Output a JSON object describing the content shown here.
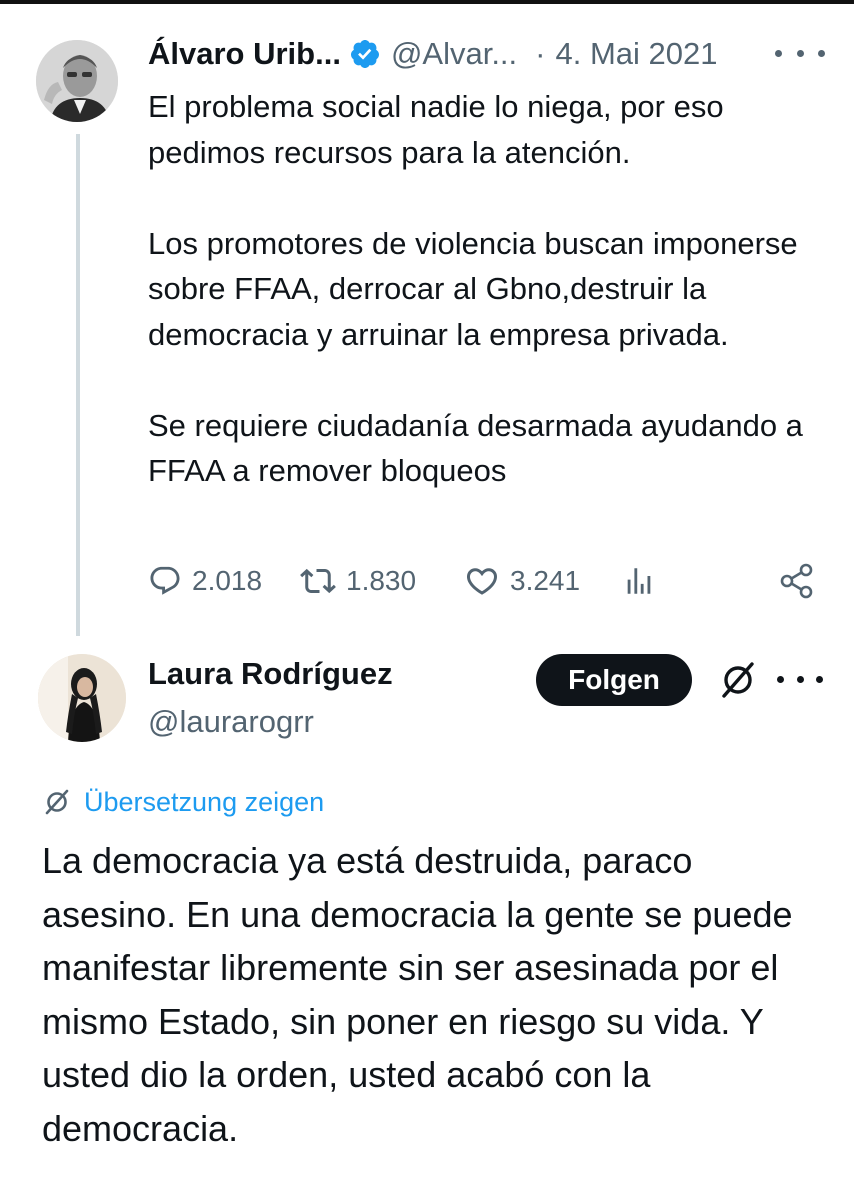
{
  "original_tweet": {
    "display_name": "Álvaro Urib...",
    "handle": "@Alvar...",
    "separator": "·",
    "date": "4. Mai 2021",
    "paragraphs": [
      "El problema social nadie lo niega, por eso pedimos recursos para la atención.",
      "Los promotores de violencia buscan imponerse sobre FFAA, derrocar al Gbno,destruir la democracia y arruinar la empresa privada.",
      "Se requiere ciudadanía desarmada ayudando a FFAA a remover bloqueos"
    ],
    "replies": "2.018",
    "retweets": "1.830",
    "likes": "3.241"
  },
  "reply_tweet": {
    "display_name": "Laura Rodríguez",
    "handle": "@laurarogrr",
    "follow_label": "Folgen",
    "translate_label": "Übersetzung zeigen",
    "text": "La democracia ya está destruida, paraco asesino. En una democracia la gente se puede manifestar libremente sin ser asesinada por el mismo Estado, sin poner en riesgo su vida. Y usted dio la orden, usted acabó con la democracia."
  },
  "colors": {
    "text": "#0f1419",
    "secondary": "#536471",
    "accent": "#1d9bf0",
    "thread_line": "#cfd9de",
    "button_bg": "#0f1419"
  }
}
